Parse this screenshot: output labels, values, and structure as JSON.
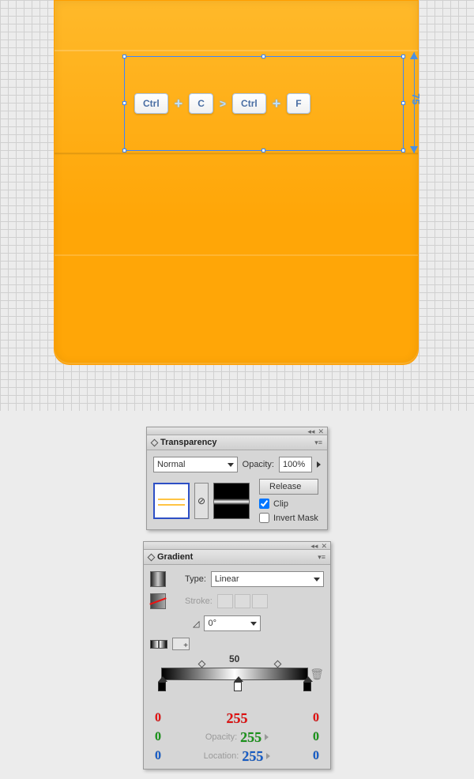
{
  "canvas": {
    "measure_label": "75",
    "keys": {
      "k1": "Ctrl",
      "k2": "C",
      "k3": "Ctrl",
      "k4": "F",
      "plus": "+",
      "chev": ">"
    }
  },
  "transparency": {
    "title": "Transparency",
    "blend_mode": "Normal",
    "opacity_label": "Opacity:",
    "opacity_value": "100%",
    "release": "Release",
    "clip_label": "Clip",
    "clip_checked": true,
    "invert_label": "Invert Mask",
    "invert_checked": false
  },
  "gradient": {
    "title": "Gradient",
    "type_label": "Type:",
    "type_value": "Linear",
    "stroke_label": "Stroke:",
    "angle_value": "0°",
    "mid_location": "50",
    "opacity_label": "Opacity:",
    "location_label": "Location:",
    "stops": {
      "left": {
        "r": "0",
        "g": "0",
        "b": "0"
      },
      "mid": {
        "r": "255",
        "g": "255",
        "b": "255"
      },
      "right": {
        "r": "0",
        "g": "0",
        "b": "0"
      }
    }
  }
}
